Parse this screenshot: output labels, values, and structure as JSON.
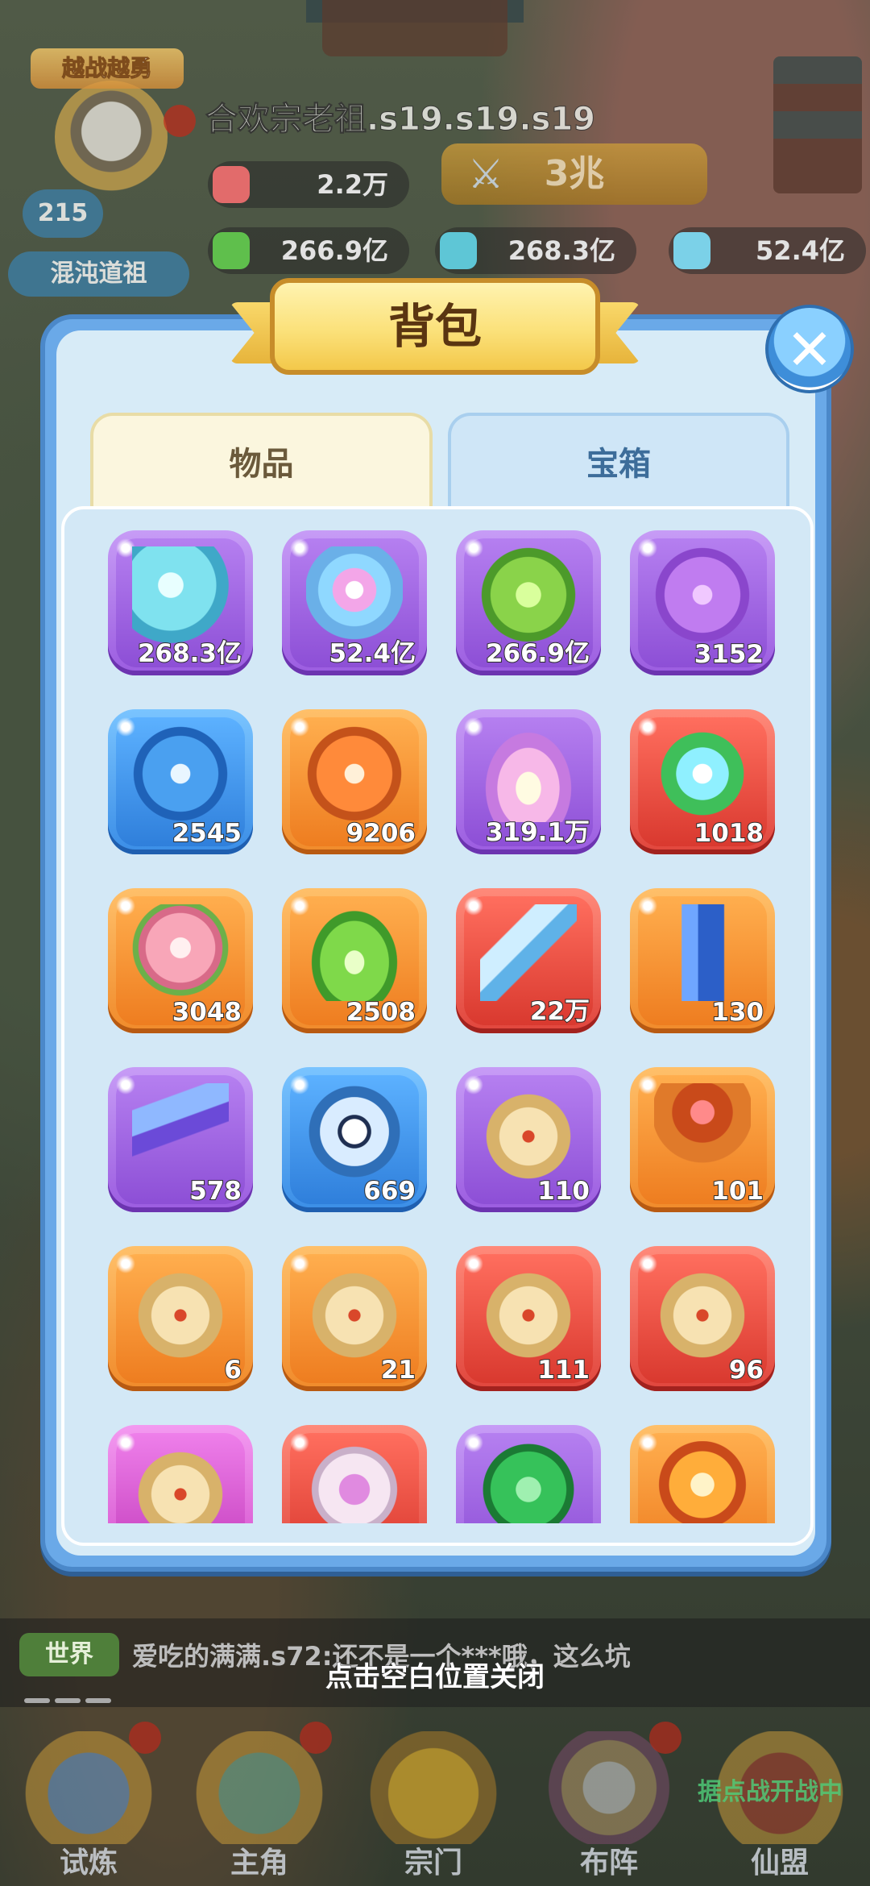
{
  "hud": {
    "badge": "越战越勇",
    "level": "215",
    "rank": "混沌道祖",
    "player_name": "合欢宗老祖.s19.s19.s19",
    "resources": [
      {
        "value": "2.2万",
        "icon": "gem-icon",
        "color": "#e26b6b"
      },
      {
        "value": "266.9亿",
        "icon": "green-jade-icon",
        "color": "#5fbf4c"
      },
      {
        "value": "268.3亿",
        "icon": "blue-crystal-icon",
        "color": "#5ec6d6"
      },
      {
        "value": "52.4亿",
        "icon": "rainbow-crystal-icon",
        "color": "#7bd1e8"
      }
    ],
    "power": "3兆"
  },
  "modal": {
    "title": "背包",
    "close_icon": "close-icon",
    "tabs": [
      {
        "label": "物品",
        "active": true
      },
      {
        "label": "宝箱",
        "active": false
      }
    ]
  },
  "items": [
    {
      "count": "268.3亿",
      "rarity": "purple",
      "icon": "blue-crystal-icon"
    },
    {
      "count": "52.4亿",
      "rarity": "purple",
      "icon": "rainbow-crystal-icon"
    },
    {
      "count": "266.9亿",
      "rarity": "purple",
      "icon": "green-jade-icon"
    },
    {
      "count": "3152",
      "rarity": "purple",
      "icon": "purple-puzzle-shard-icon"
    },
    {
      "count": "2545",
      "rarity": "blue",
      "icon": "blue-puzzle-shard-icon"
    },
    {
      "count": "9206",
      "rarity": "orange",
      "icon": "orange-puzzle-shard-icon"
    },
    {
      "count": "319.1万",
      "rarity": "purple",
      "icon": "lotus-petals-icon"
    },
    {
      "count": "1018",
      "rarity": "red",
      "icon": "spirit-orb-icon"
    },
    {
      "count": "3048",
      "rarity": "orange",
      "icon": "peach-icon"
    },
    {
      "count": "2508",
      "rarity": "orange",
      "icon": "green-flame-icon"
    },
    {
      "count": "22万",
      "rarity": "red",
      "icon": "ice-sword-icon"
    },
    {
      "count": "130",
      "rarity": "orange",
      "icon": "blue-pillar-icon"
    },
    {
      "count": "578",
      "rarity": "purple",
      "icon": "spear-flag-icon"
    },
    {
      "count": "669",
      "rarity": "blue",
      "icon": "bagua-icon"
    },
    {
      "count": "110",
      "rarity": "purple",
      "icon": "scroll-icon"
    },
    {
      "count": "101",
      "rarity": "orange",
      "icon": "altar-icon"
    },
    {
      "count": "6",
      "rarity": "orange",
      "icon": "scroll-icon"
    },
    {
      "count": "21",
      "rarity": "orange",
      "icon": "scroll-icon"
    },
    {
      "count": "111",
      "rarity": "red",
      "icon": "scroll-icon"
    },
    {
      "count": "96",
      "rarity": "red",
      "icon": "scroll-icon"
    },
    {
      "count": "",
      "rarity": "pink",
      "icon": "scroll-icon"
    },
    {
      "count": "",
      "rarity": "red",
      "icon": "pills-box-icon"
    },
    {
      "count": "",
      "rarity": "purple",
      "icon": "jade-token-icon"
    },
    {
      "count": "",
      "rarity": "orange",
      "icon": "fire-orb-icon"
    }
  ],
  "chat": {
    "channel": "世界",
    "message": "爱吃的满满.s72:还不是一个***哦，这么坑"
  },
  "close_hint": "点击空白位置关闭",
  "nav": [
    {
      "label": "试炼",
      "icon": "trial-icon"
    },
    {
      "label": "主角",
      "icon": "hero-icon"
    },
    {
      "label": "宗门",
      "icon": "sect-icon"
    },
    {
      "label": "布阵",
      "icon": "formation-icon"
    },
    {
      "label": "仙盟",
      "icon": "alliance-icon"
    }
  ],
  "war_banner": "据点战开战中"
}
